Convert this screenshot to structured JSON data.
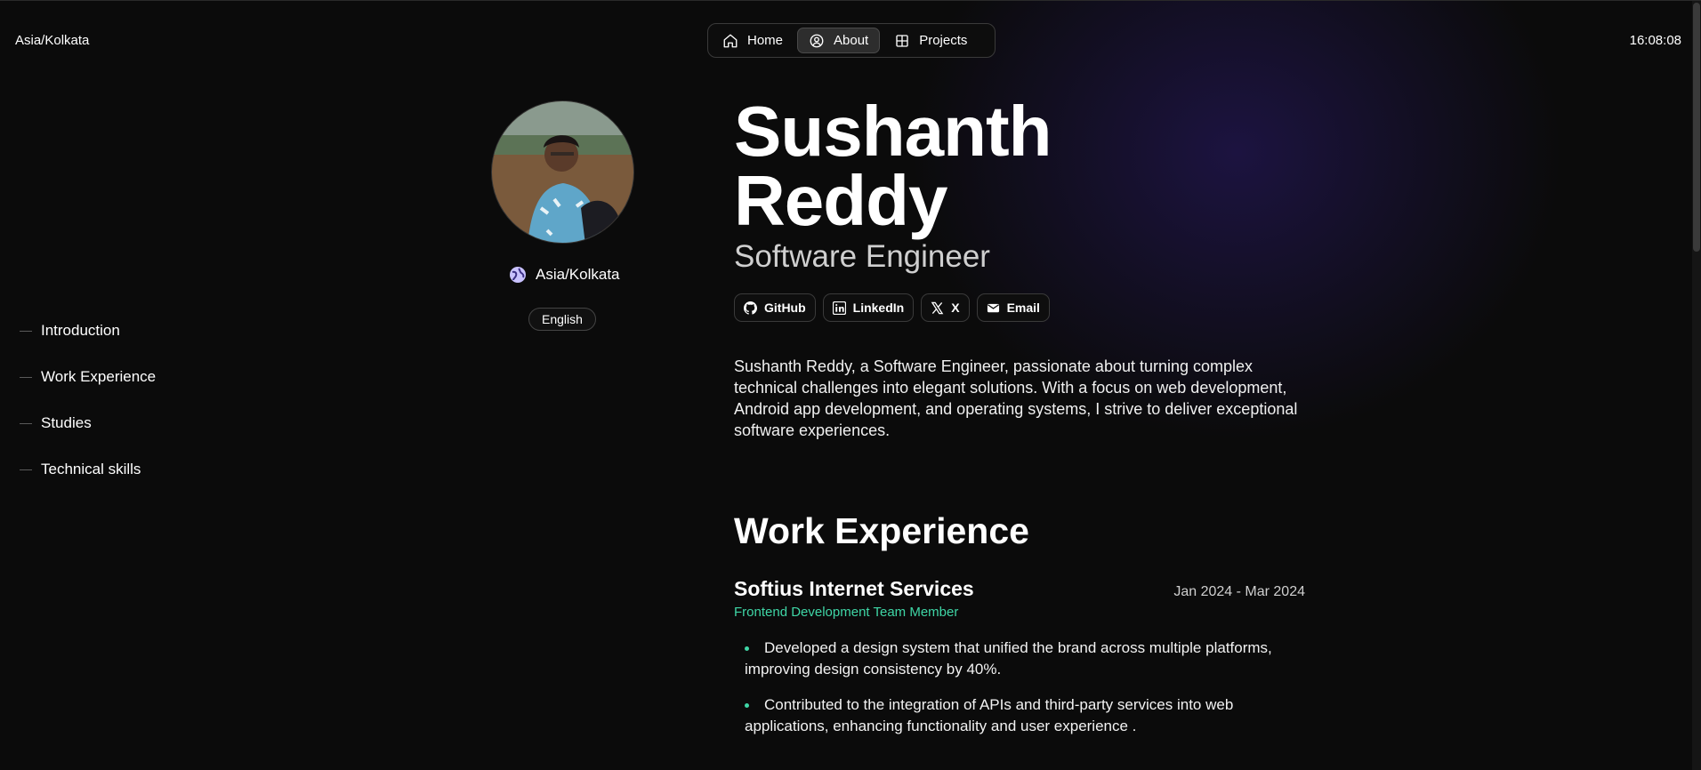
{
  "header": {
    "timezone": "Asia/Kolkata",
    "clock": "16:08:08",
    "nav": [
      {
        "label": "Home",
        "icon": "home-icon"
      },
      {
        "label": "About",
        "icon": "user-circle-icon",
        "active": true
      },
      {
        "label": "Projects",
        "icon": "grid-icon"
      }
    ]
  },
  "toc": {
    "items": [
      "Introduction",
      "Work Experience",
      "Studies",
      "Technical skills"
    ]
  },
  "profile": {
    "location": "Asia/Kolkata",
    "language": "English"
  },
  "hero": {
    "name_line1": "Sushanth",
    "name_line2": "Reddy",
    "role": "Software Engineer",
    "socials": [
      {
        "label": "GitHub",
        "icon": "github-icon"
      },
      {
        "label": "LinkedIn",
        "icon": "linkedin-icon"
      },
      {
        "label": "X",
        "icon": "x-icon"
      },
      {
        "label": "Email",
        "icon": "email-icon"
      }
    ],
    "intro": "Sushanth Reddy, a Software Engineer, passionate about turning complex technical challenges into elegant solutions. With a focus on web development, Android app development, and operating systems, I strive to deliver exceptional software experiences."
  },
  "work": {
    "title": "Work Experience",
    "jobs": [
      {
        "company": "Softius Internet Services",
        "dates": "Jan 2024 - Mar 2024",
        "role": "Frontend Development Team Member",
        "bullets": [
          "Developed a design system that unified the brand across multiple platforms, improving design consistency by 40%.",
          "Contributed to the integration of APIs and third-party services into web applications, enhancing functionality and user experience ."
        ]
      }
    ]
  },
  "colors": {
    "accent": "#3fd6a6",
    "background": "#0b0b0b",
    "glow": "#2a1a6c"
  }
}
